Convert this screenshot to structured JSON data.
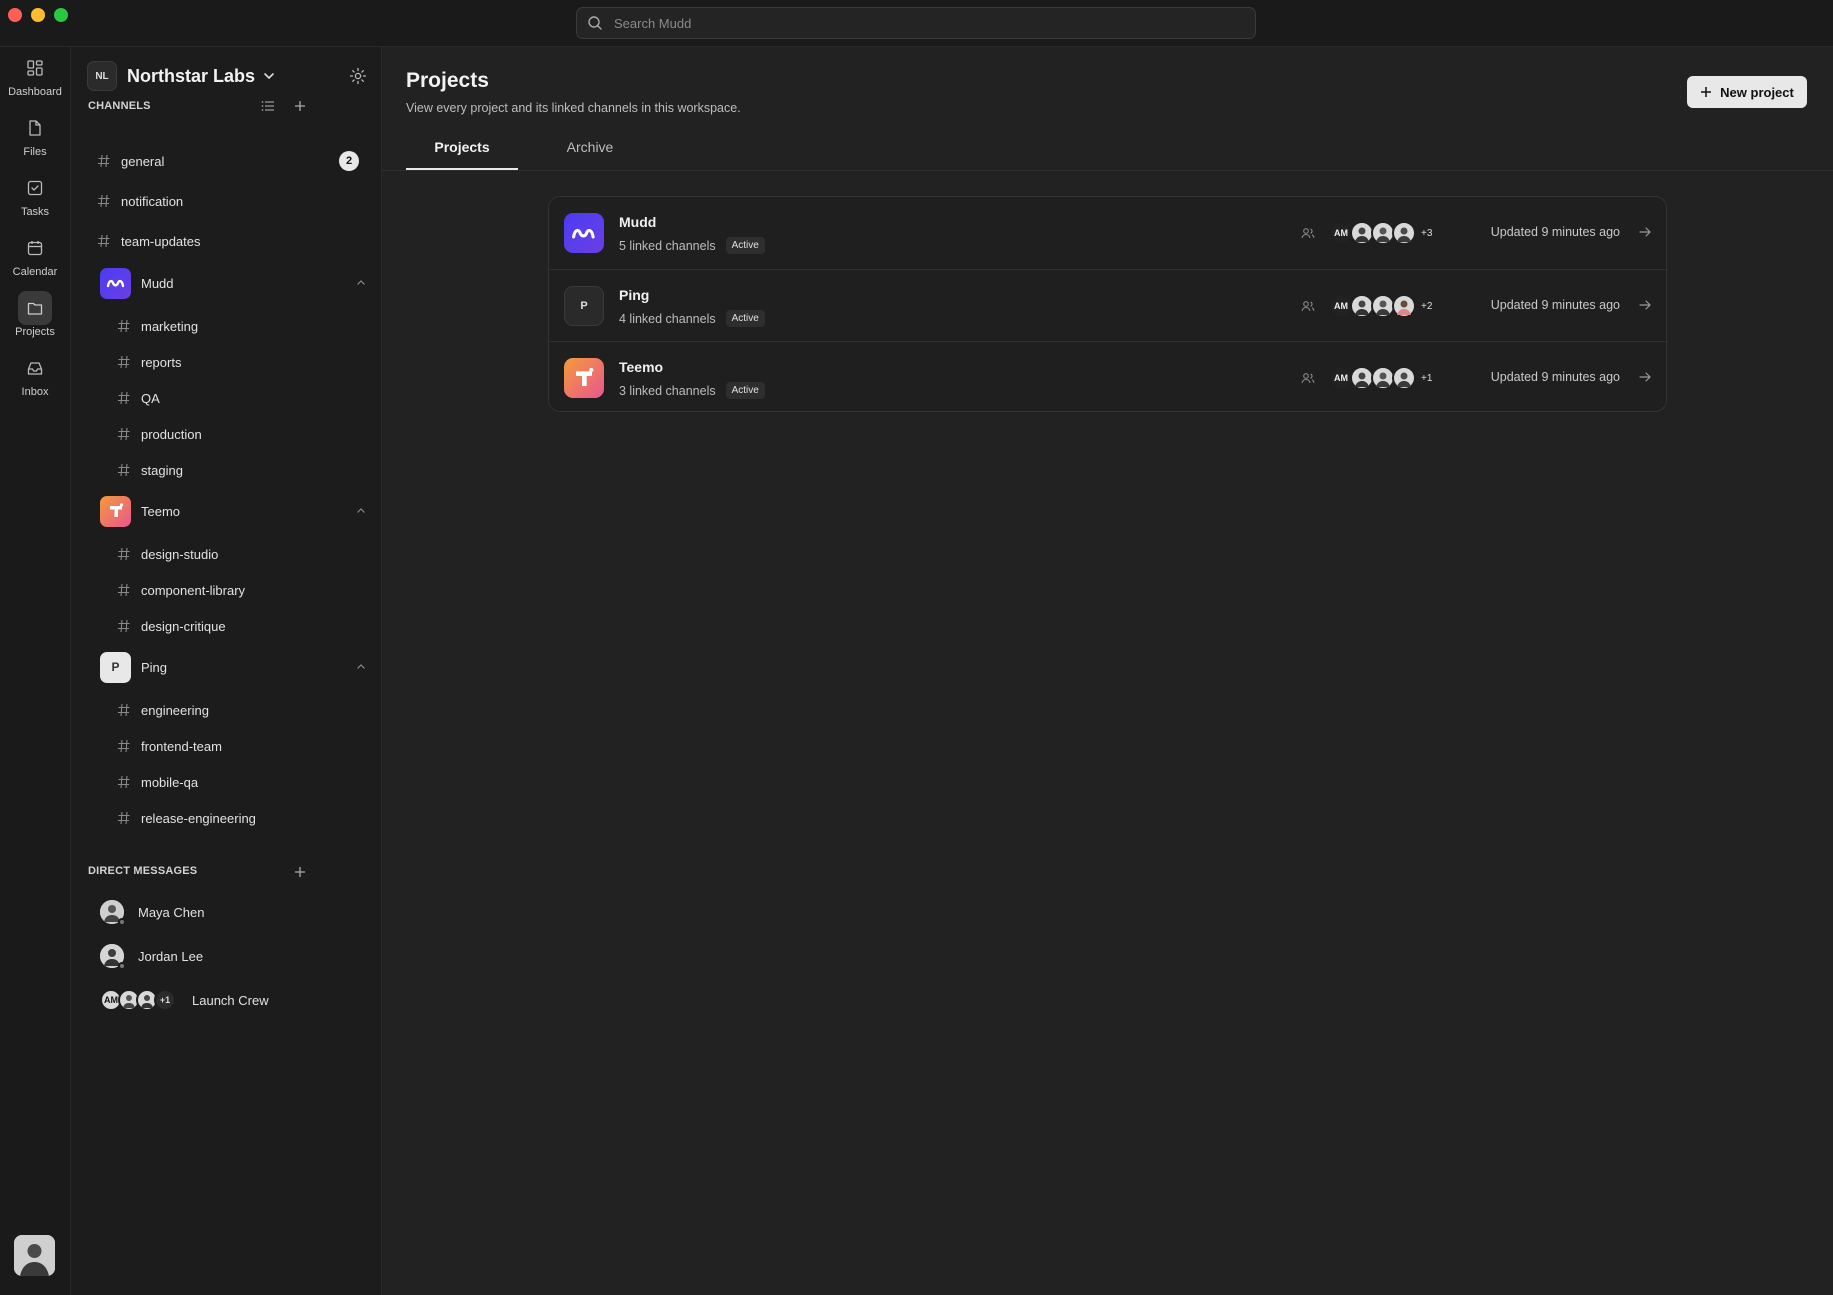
{
  "search": {
    "placeholder": "Search Mudd"
  },
  "rail": {
    "items": [
      {
        "label": "Dashboard",
        "icon": "dashboard-icon"
      },
      {
        "label": "Files",
        "icon": "file-icon"
      },
      {
        "label": "Tasks",
        "icon": "task-icon"
      },
      {
        "label": "Calendar",
        "icon": "calendar-icon"
      },
      {
        "label": "Projects",
        "icon": "projects-icon",
        "active": true
      },
      {
        "label": "Inbox",
        "icon": "inbox-icon"
      }
    ]
  },
  "workspace": {
    "badge": "NL",
    "name": "Northstar Labs"
  },
  "channels": {
    "title": "CHANNELS",
    "items": [
      {
        "label": "general",
        "badge": "2"
      },
      {
        "label": "notification"
      },
      {
        "label": "team-updates"
      }
    ]
  },
  "projects_tree": [
    {
      "name": "Mudd",
      "channels": [
        "marketing",
        "reports",
        "QA",
        "production",
        "staging"
      ]
    },
    {
      "name": "Teemo",
      "channels": [
        "design-studio",
        "component-library",
        "design-critique"
      ]
    },
    {
      "name": "Ping",
      "logo_letter": "P",
      "channels": [
        "engineering",
        "frontend-team",
        "mobile-qa",
        "release-engineering"
      ]
    }
  ],
  "direct_messages": {
    "title": "DIRECT MESSAGES",
    "items": [
      {
        "label": "Maya Chen"
      },
      {
        "label": "Jordan Lee"
      },
      {
        "label": "Launch Crew",
        "initials": "AM",
        "more": "+1"
      }
    ]
  },
  "main": {
    "title": "Projects",
    "subtitle": "View every project and its linked channels in this workspace.",
    "new_button": "New project",
    "tabs": [
      {
        "label": "Projects",
        "active": true
      },
      {
        "label": "Archive"
      }
    ],
    "rows": [
      {
        "name": "Mudd",
        "channels": "5 linked channels",
        "status": "Active",
        "initials": "AM",
        "more": "+3",
        "updated": "Updated 9 minutes ago"
      },
      {
        "name": "Ping",
        "logo_letter": "P",
        "channels": "4 linked channels",
        "status": "Active",
        "initials": "AM",
        "more": "+2",
        "updated": "Updated 9 minutes ago"
      },
      {
        "name": "Teemo",
        "channels": "3 linked channels",
        "status": "Active",
        "initials": "AM",
        "more": "+1",
        "updated": "Updated 9 minutes ago"
      }
    ]
  },
  "colors": {
    "background": "#222222",
    "sidebar": "#1c1c1c",
    "accent_mudd": "#4b3cf2",
    "accent_teemo": "#f59a3b"
  }
}
